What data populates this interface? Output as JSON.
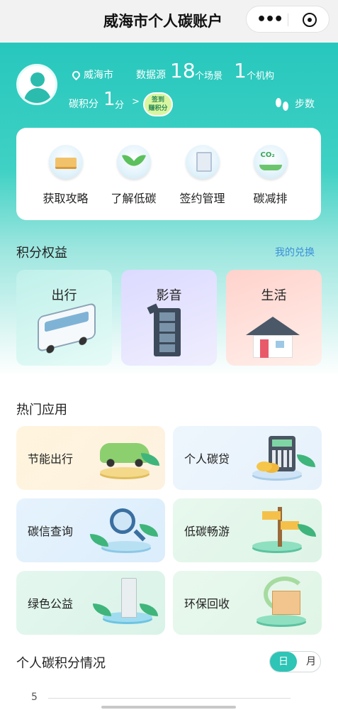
{
  "window": {
    "title": "威海市个人碳账户",
    "more_icon": "more-dots-icon",
    "close_icon": "close-circle-icon"
  },
  "profile": {
    "city": "威海市",
    "datasource_label": "数据源",
    "scene_count": "18",
    "scene_unit": "个场景",
    "org_count": "1",
    "org_unit": "个机构",
    "points_label": "碳积分",
    "points_value": "1",
    "points_unit": "分",
    "chevron": ">",
    "earn_badge": "签到\n赚积分",
    "steps_label": "步数"
  },
  "quick_actions": [
    {
      "label": "获取攻略",
      "icon": "book-icon"
    },
    {
      "label": "了解低碳",
      "icon": "sprout-icon"
    },
    {
      "label": "签约管理",
      "icon": "document-gear-icon"
    },
    {
      "label": "碳减排",
      "icon": "co2-leaf-icon"
    }
  ],
  "benefits": {
    "title": "积分权益",
    "link": "我的兑换",
    "items": [
      {
        "label": "出行",
        "icon": "bus-icon"
      },
      {
        "label": "影音",
        "icon": "film-icon"
      },
      {
        "label": "生活",
        "icon": "house-icon"
      }
    ]
  },
  "hot_apps": {
    "title": "热门应用",
    "items": [
      {
        "label": "节能出行",
        "icon": "car-icon"
      },
      {
        "label": "个人碳贷",
        "icon": "calculator-icon"
      },
      {
        "label": "碳信查询",
        "icon": "magnifier-icon"
      },
      {
        "label": "低碳畅游",
        "icon": "signpost-icon"
      },
      {
        "label": "绿色公益",
        "icon": "stele-icon"
      },
      {
        "label": "环保回收",
        "icon": "recycle-box-icon"
      }
    ]
  },
  "score_section": {
    "title": "个人碳积分情况",
    "toggle_day": "日",
    "toggle_month": "月",
    "y_tick": "5"
  },
  "colors": {
    "accent": "#2ec4b6",
    "link": "#3b8fd9"
  }
}
